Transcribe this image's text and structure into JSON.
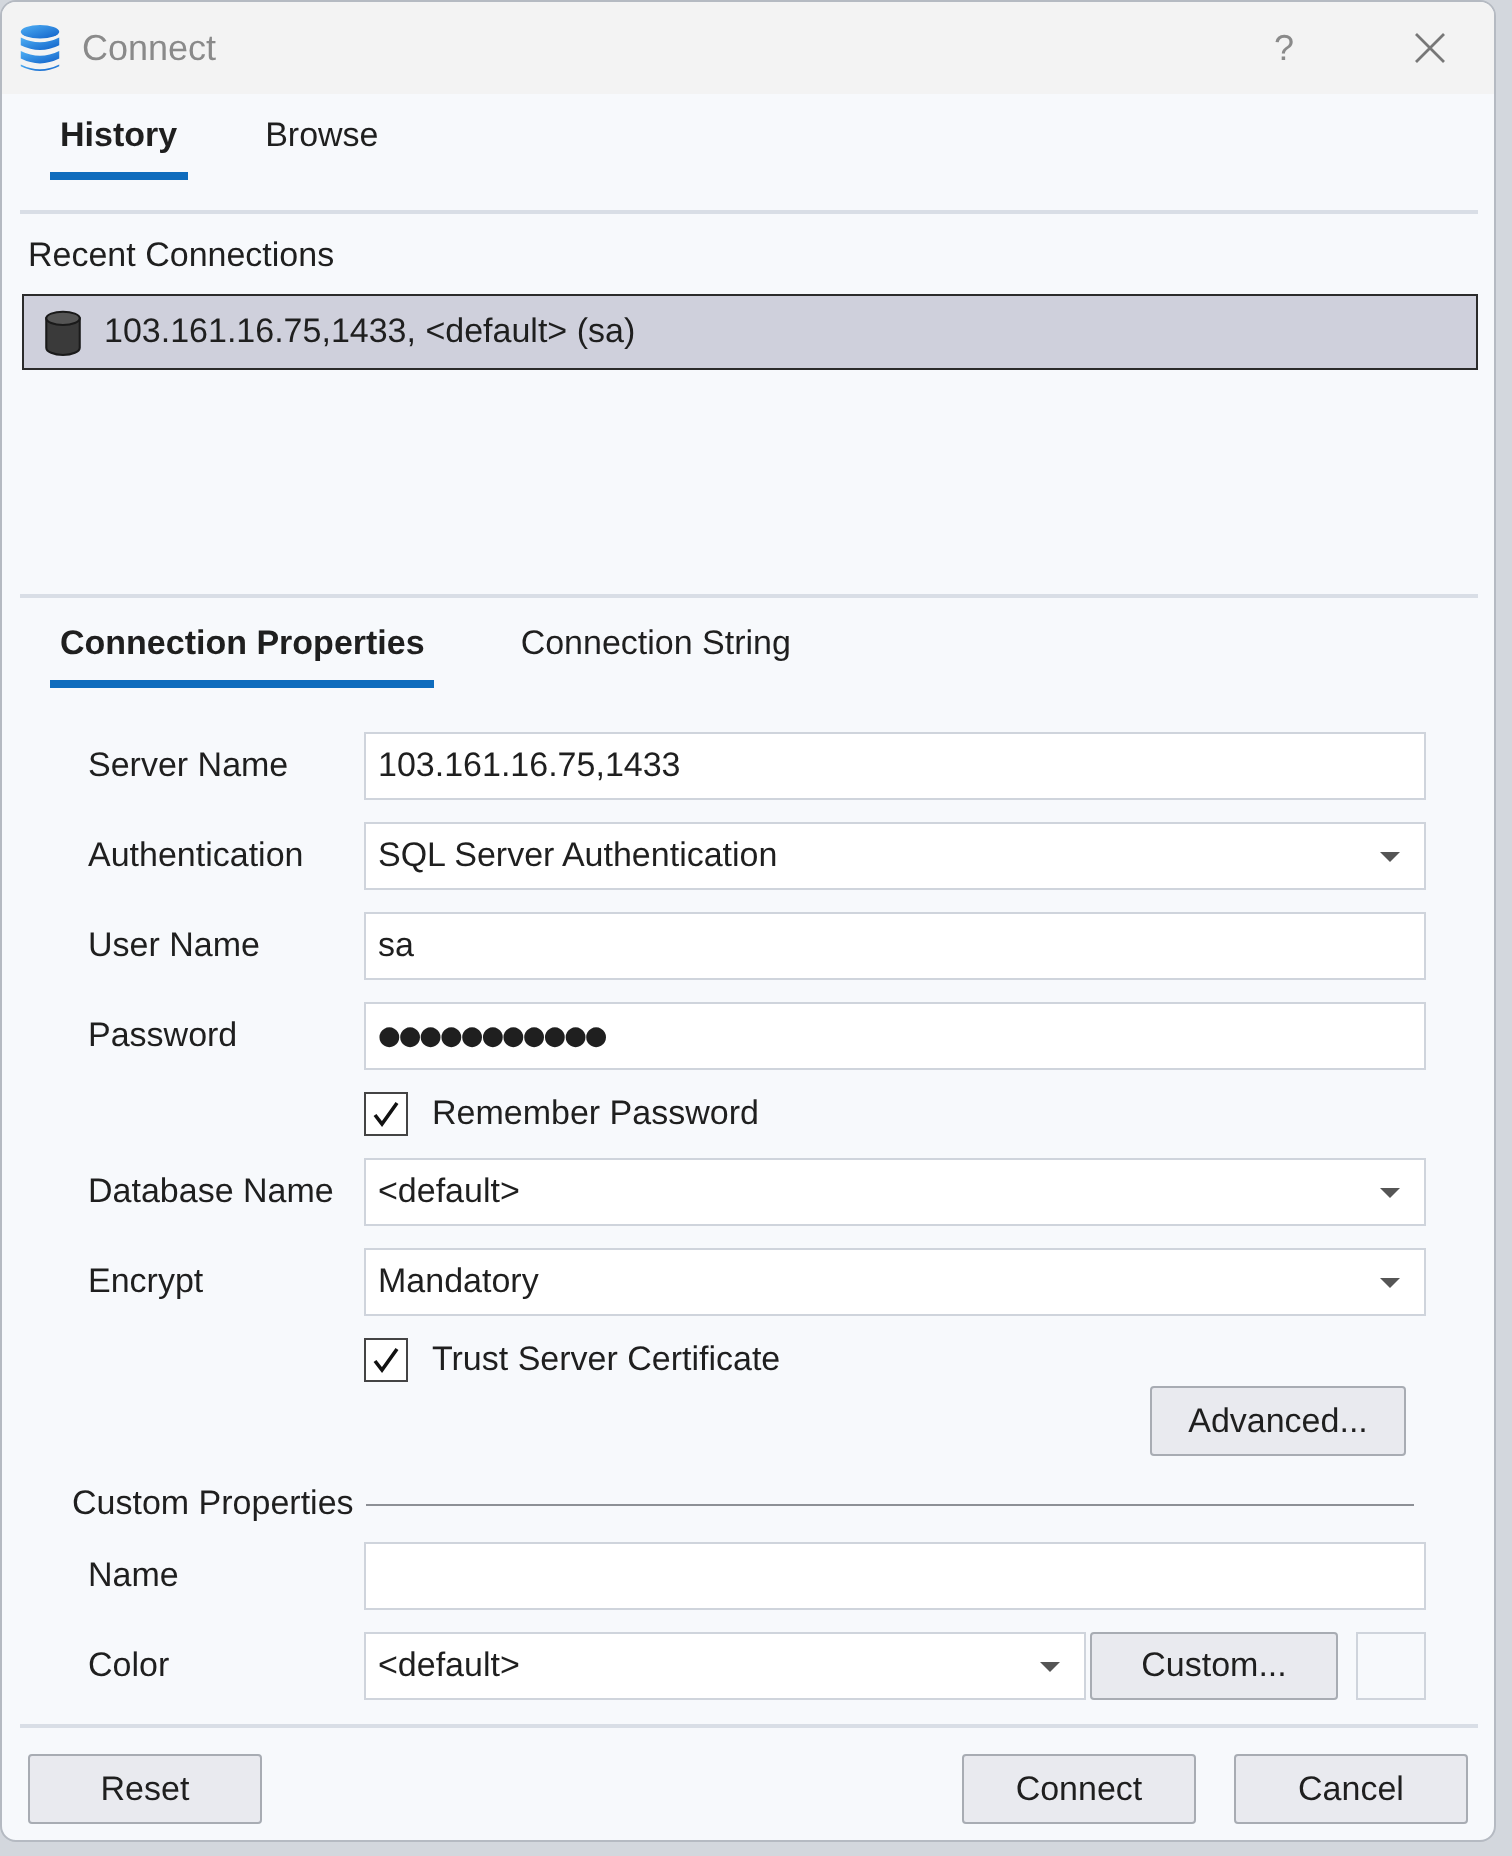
{
  "window": {
    "title": "Connect",
    "help": "?"
  },
  "top_tabs": [
    {
      "label": "History",
      "selected": true
    },
    {
      "label": "Browse",
      "selected": false
    }
  ],
  "recent_connections": {
    "heading": "Recent Connections",
    "items": [
      {
        "label": "103.161.16.75,1433, <default> (sa)",
        "selected": true
      }
    ]
  },
  "property_tabs": [
    {
      "label": "Connection Properties",
      "selected": true
    },
    {
      "label": "Connection String",
      "selected": false
    }
  ],
  "connection_form": {
    "rows": [
      {
        "kind": "text",
        "label": "Server Name",
        "value": "103.161.16.75,1433"
      },
      {
        "kind": "dropdown",
        "label": "Authentication",
        "value": "SQL Server Authentication"
      },
      {
        "kind": "text",
        "label": "User Name",
        "value": "sa"
      },
      {
        "kind": "password",
        "label": "Password",
        "value": "●●●●●●●●●●●"
      },
      {
        "kind": "checkbox",
        "label": "Remember Password",
        "checked": true
      },
      {
        "kind": "dropdown",
        "label": "Database Name",
        "value": "<default>"
      },
      {
        "kind": "dropdown",
        "label": "Encrypt",
        "value": "Mandatory"
      },
      {
        "kind": "checkbox",
        "label": "Trust Server Certificate",
        "checked": true
      }
    ],
    "advanced_button": "Advanced..."
  },
  "custom_properties": {
    "heading": "Custom Properties",
    "name_label": "Name",
    "color_label": "Color",
    "color_value": "<default>",
    "custom_button": "Custom..."
  },
  "footer": {
    "left_buttons": [
      "Reset"
    ],
    "right_buttons": [
      "Connect",
      "Cancel"
    ]
  }
}
